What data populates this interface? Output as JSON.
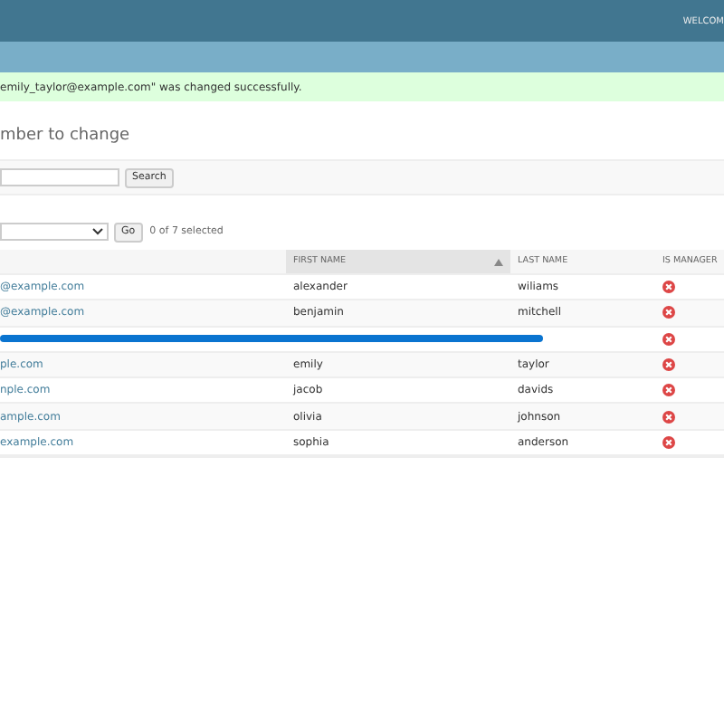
{
  "header": {
    "user_text": "WELCOM"
  },
  "message": {
    "text": "emily_taylor@example.com\" was changed successfully."
  },
  "title": "mber to change",
  "search": {
    "button": "Search"
  },
  "actions": {
    "button": "Go",
    "selection": "0 of 7 selected"
  },
  "table": {
    "columns": [
      {
        "sorted": false
      },
      {
        "label": "FIRST NAME",
        "sorted": true
      },
      {
        "label": "LAST NAME",
        "sorted": false
      },
      {
        "label": "IS MANAGER",
        "sorted": false
      }
    ],
    "rows": [
      {
        "kind": "plain",
        "email": "@example.com",
        "first_name": "alexander",
        "last_name": "wiliams",
        "is_manager": false
      },
      {
        "kind": "plain",
        "email": "@example.com",
        "first_name": "benjamin",
        "last_name": "mitchell",
        "is_manager": false
      },
      {
        "kind": "redacted",
        "is_manager": false
      },
      {
        "kind": "plain",
        "email": "ple.com",
        "first_name": "emily",
        "last_name": "taylor",
        "is_manager": false
      },
      {
        "kind": "plain",
        "email": "nple.com",
        "first_name": "jacob",
        "last_name": "davids",
        "is_manager": false
      },
      {
        "kind": "plain",
        "email": "ample.com",
        "first_name": "olivia",
        "last_name": "johnson",
        "is_manager": false
      },
      {
        "kind": "plain",
        "email": "example.com",
        "first_name": "sophia",
        "last_name": "anderson",
        "is_manager": false
      }
    ]
  }
}
